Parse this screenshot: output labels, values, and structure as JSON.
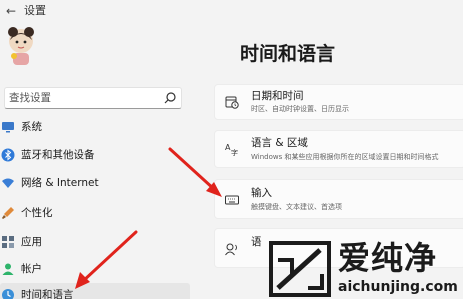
{
  "window": {
    "title": "设置"
  },
  "search": {
    "placeholder": "查找设置"
  },
  "sidebar": {
    "items": [
      {
        "label": "系统",
        "icon": "monitor-icon",
        "color": "#3a78c9"
      },
      {
        "label": "蓝牙和其他设备",
        "icon": "bluetooth-icon",
        "color": "#2f7ad8"
      },
      {
        "label": "网络 & Internet",
        "icon": "wifi-icon",
        "color": "#3a7ed6"
      },
      {
        "label": "个性化",
        "icon": "brush-icon",
        "color": "#e08a3a"
      },
      {
        "label": "应用",
        "icon": "apps-icon",
        "color": "#5a6c80"
      },
      {
        "label": "帐户",
        "icon": "person-icon",
        "color": "#2eb46b"
      },
      {
        "label": "时间和语言",
        "icon": "globe-clock-icon",
        "color": "#3a8fd8",
        "active": true
      }
    ]
  },
  "main": {
    "title": "时间和语言",
    "cards": [
      {
        "title": "日期和时间",
        "subtitle": "时区、自动时钟设置、日历显示",
        "icon": "calendar-clock-icon"
      },
      {
        "title": "语言 & 区域",
        "subtitle": "Windows 和某些应用根据你所在的区域设置日期和时间格式",
        "icon": "language-icon"
      },
      {
        "title": "输入",
        "subtitle": "触摸键盘、文本建议、首选项",
        "icon": "keyboard-icon"
      },
      {
        "title": "语",
        "subtitle": "",
        "icon": "speech-icon"
      }
    ]
  },
  "watermark": {
    "text": "爱纯净",
    "url": "aichunjing.com"
  },
  "colors": {
    "arrow": "#e0231c",
    "accent": "#0067c0"
  }
}
